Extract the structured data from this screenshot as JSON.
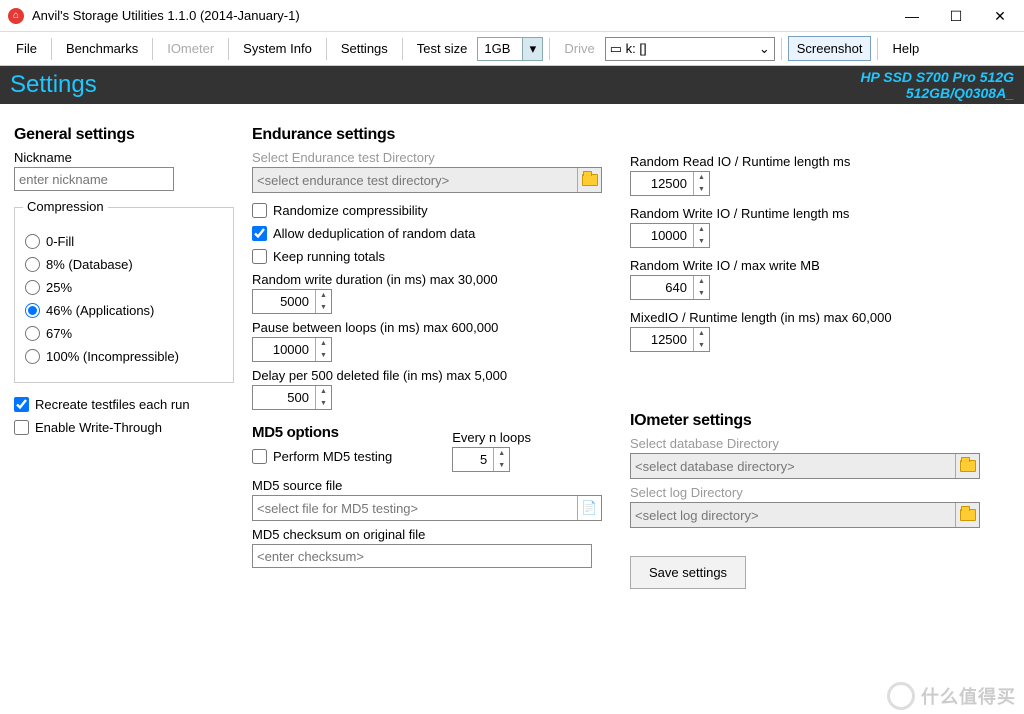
{
  "window": {
    "title": "Anvil's Storage Utilities 1.1.0 (2014-January-1)"
  },
  "menu": {
    "file": "File",
    "benchmarks": "Benchmarks",
    "iometer": "IOmeter",
    "sysinfo": "System Info",
    "settings": "Settings",
    "testsize": "Test size",
    "testsize_val": "1GB",
    "drive": "Drive",
    "drive_val": "k: []",
    "screenshot": "Screenshot",
    "help": "Help"
  },
  "header": {
    "title": "Settings",
    "device_line1": "HP SSD S700 Pro 512G",
    "device_line2": "512GB/Q0308A_"
  },
  "general": {
    "title": "General settings",
    "nickname_label": "Nickname",
    "nickname_ph": "enter nickname",
    "compression_legend": "Compression",
    "opts": [
      "0-Fill",
      "8% (Database)",
      "25%",
      "46% (Applications)",
      "67%",
      "100% (Incompressible)"
    ],
    "recreate": "Recreate testfiles each run",
    "writethrough": "Enable Write-Through"
  },
  "endurance": {
    "title": "Endurance settings",
    "dir_label": "Select Endurance test Directory",
    "dir_ph": "<select endurance test directory>",
    "rand_comp": "Randomize compressibility",
    "dedup": "Allow deduplication of random data",
    "keep_totals": "Keep running totals",
    "rw_dur_label": "Random write duration (in ms) max 30,000",
    "rw_dur_val": "5000",
    "pause_label": "Pause between loops (in ms) max 600,000",
    "pause_val": "10000",
    "delay_label": "Delay per 500 deleted file (in ms) max 5,000",
    "delay_val": "500",
    "md5_title": "MD5 options",
    "md5_perform": "Perform MD5 testing",
    "md5_every_label": "Every n loops",
    "md5_every_val": "5",
    "md5_src_label": "MD5 source file",
    "md5_src_ph": "<select file for MD5 testing>",
    "md5_chk_label": "MD5 checksum on original file",
    "md5_chk_ph": "<enter checksum>"
  },
  "right": {
    "rr_label": "Random Read IO / Runtime length ms",
    "rr_val": "12500",
    "rw_label": "Random Write IO / Runtime length ms",
    "rw_val": "10000",
    "rwmax_label": "Random Write IO / max write MB",
    "rwmax_val": "640",
    "mixed_label": "MixedIO / Runtime length (in ms) max 60,000",
    "mixed_val": "12500",
    "io_title": "IOmeter settings",
    "io_db_label": "Select database Directory",
    "io_db_ph": "<select database directory>",
    "io_log_label": "Select log Directory",
    "io_log_ph": "<select log directory>",
    "save": "Save settings"
  },
  "watermark": "什么值得买"
}
